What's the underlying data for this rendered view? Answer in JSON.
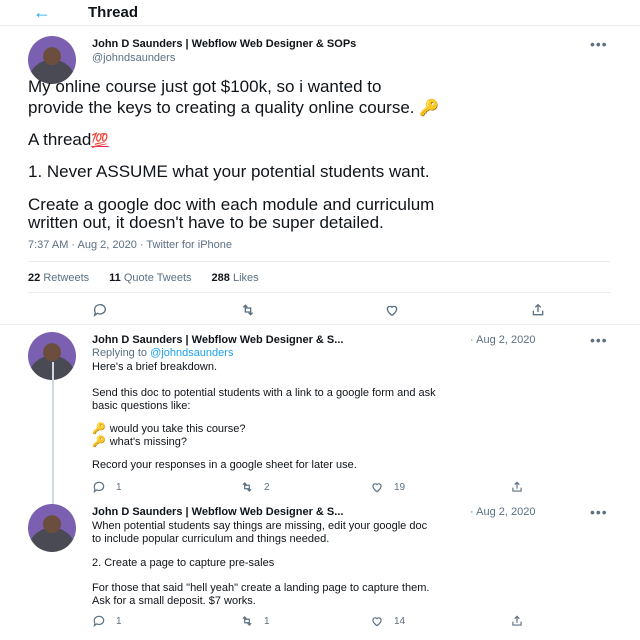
{
  "header": {
    "back_icon": "back-arrow-icon",
    "title": "Thread"
  },
  "main_tweet": {
    "name": "John D Saunders | Webflow Web Designer & SOPs",
    "handle": "@johndsaunders",
    "line1": "My online course just got $100k, so i wanted to",
    "line2": "provide the keys to creating a quality online course.",
    "key_emoji": "🔑",
    "line3": "A thread",
    "hundred_emoji": "💯",
    "line4": "1. Never ASSUME what your potential students want.",
    "line5": "Create a google doc with each module and curriculum",
    "line6": "written out, it doesn't have to be super detailed.",
    "meta": "7:37 AM · Aug 2, 2020 · Twitter for iPhone",
    "retweets_count": "22",
    "retweets_label": "Retweets",
    "quotes_count": "11",
    "quotes_label": "Quote Tweets",
    "likes_count": "288",
    "likes_label": "Likes"
  },
  "reply1": {
    "name": "John D Saunders | Webflow Web Designer & S...",
    "date": "· Aug 2, 2020",
    "replying_prefix": "Replying to",
    "replying_handle": "@johndsaunders",
    "line1": "Here's a brief breakdown.",
    "line2": "Send this doc to potential students with a link to a google form and ask",
    "line3": "basic questions like:",
    "bullet1": "would you take this course?",
    "bullet2": "what's missing?",
    "line4": "Record your responses in a google sheet for later use.",
    "reply_count": "1",
    "retweet_count": "2",
    "like_count": "19"
  },
  "reply2": {
    "name": "John D Saunders | Webflow Web Designer & S...",
    "date": "· Aug 2, 2020",
    "line1": "When potential students say things are missing, edit your google doc",
    "line2": "to include popular curriculum and things needed.",
    "line3": "2. Create a page to capture pre-sales",
    "line4": "For those that said \"hell yeah\" create a landing page to capture them.",
    "line5": "Ask for a small deposit. $7 works.",
    "reply_count": "1",
    "retweet_count": "1",
    "like_count": "14"
  },
  "more_icon": "•••",
  "colors": {
    "accent": "#1da1f2",
    "muted": "#5b7083",
    "key": "#c9662c",
    "hundred": "#e0245e"
  }
}
